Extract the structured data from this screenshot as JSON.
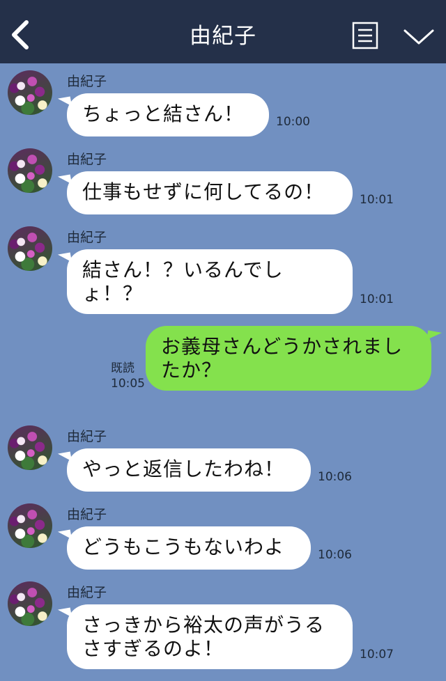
{
  "header": {
    "title": "由紀子"
  },
  "messages": [
    {
      "sender": "由紀子",
      "text": "ちょっと結さん！",
      "time": "10:00"
    },
    {
      "sender": "由紀子",
      "text": "仕事もせずに何してるの！",
      "time": "10:01"
    },
    {
      "sender": "由紀子",
      "text": "結さん！？いるんでしょ！？",
      "time": "10:01"
    },
    {
      "text": "お義母さんどうかされましたか？",
      "read": "既読",
      "time": "10:05"
    },
    {
      "sender": "由紀子",
      "text": "やっと返信したわね！",
      "time": "10:06"
    },
    {
      "sender": "由紀子",
      "text": "どうもこうもないわよ",
      "time": "10:06"
    },
    {
      "sender": "由紀子",
      "text": "さっきから裕太の声がうるさすぎるのよ！",
      "time": "10:07"
    }
  ],
  "colors": {
    "header_bg": "#243049",
    "chat_bg": "#7190c1",
    "sent_bubble": "#84e14d",
    "received_bubble": "#ffffff"
  }
}
